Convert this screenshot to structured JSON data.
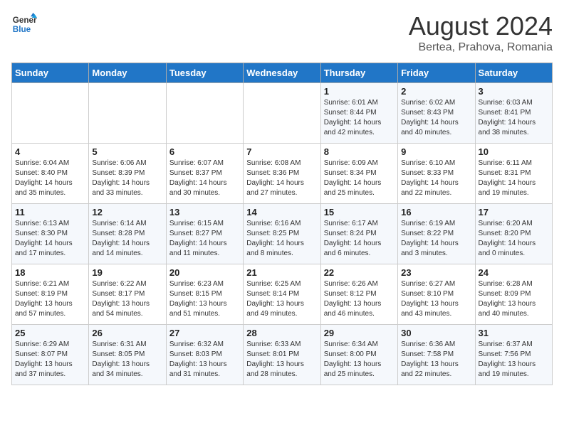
{
  "header": {
    "logo_line1": "General",
    "logo_line2": "Blue",
    "month_title": "August 2024",
    "location": "Bertea, Prahova, Romania"
  },
  "weekdays": [
    "Sunday",
    "Monday",
    "Tuesday",
    "Wednesday",
    "Thursday",
    "Friday",
    "Saturday"
  ],
  "weeks": [
    [
      {
        "day": "",
        "info": ""
      },
      {
        "day": "",
        "info": ""
      },
      {
        "day": "",
        "info": ""
      },
      {
        "day": "",
        "info": ""
      },
      {
        "day": "1",
        "info": "Sunrise: 6:01 AM\nSunset: 8:44 PM\nDaylight: 14 hours\nand 42 minutes."
      },
      {
        "day": "2",
        "info": "Sunrise: 6:02 AM\nSunset: 8:43 PM\nDaylight: 14 hours\nand 40 minutes."
      },
      {
        "day": "3",
        "info": "Sunrise: 6:03 AM\nSunset: 8:41 PM\nDaylight: 14 hours\nand 38 minutes."
      }
    ],
    [
      {
        "day": "4",
        "info": "Sunrise: 6:04 AM\nSunset: 8:40 PM\nDaylight: 14 hours\nand 35 minutes."
      },
      {
        "day": "5",
        "info": "Sunrise: 6:06 AM\nSunset: 8:39 PM\nDaylight: 14 hours\nand 33 minutes."
      },
      {
        "day": "6",
        "info": "Sunrise: 6:07 AM\nSunset: 8:37 PM\nDaylight: 14 hours\nand 30 minutes."
      },
      {
        "day": "7",
        "info": "Sunrise: 6:08 AM\nSunset: 8:36 PM\nDaylight: 14 hours\nand 27 minutes."
      },
      {
        "day": "8",
        "info": "Sunrise: 6:09 AM\nSunset: 8:34 PM\nDaylight: 14 hours\nand 25 minutes."
      },
      {
        "day": "9",
        "info": "Sunrise: 6:10 AM\nSunset: 8:33 PM\nDaylight: 14 hours\nand 22 minutes."
      },
      {
        "day": "10",
        "info": "Sunrise: 6:11 AM\nSunset: 8:31 PM\nDaylight: 14 hours\nand 19 minutes."
      }
    ],
    [
      {
        "day": "11",
        "info": "Sunrise: 6:13 AM\nSunset: 8:30 PM\nDaylight: 14 hours\nand 17 minutes."
      },
      {
        "day": "12",
        "info": "Sunrise: 6:14 AM\nSunset: 8:28 PM\nDaylight: 14 hours\nand 14 minutes."
      },
      {
        "day": "13",
        "info": "Sunrise: 6:15 AM\nSunset: 8:27 PM\nDaylight: 14 hours\nand 11 minutes."
      },
      {
        "day": "14",
        "info": "Sunrise: 6:16 AM\nSunset: 8:25 PM\nDaylight: 14 hours\nand 8 minutes."
      },
      {
        "day": "15",
        "info": "Sunrise: 6:17 AM\nSunset: 8:24 PM\nDaylight: 14 hours\nand 6 minutes."
      },
      {
        "day": "16",
        "info": "Sunrise: 6:19 AM\nSunset: 8:22 PM\nDaylight: 14 hours\nand 3 minutes."
      },
      {
        "day": "17",
        "info": "Sunrise: 6:20 AM\nSunset: 8:20 PM\nDaylight: 14 hours\nand 0 minutes."
      }
    ],
    [
      {
        "day": "18",
        "info": "Sunrise: 6:21 AM\nSunset: 8:19 PM\nDaylight: 13 hours\nand 57 minutes."
      },
      {
        "day": "19",
        "info": "Sunrise: 6:22 AM\nSunset: 8:17 PM\nDaylight: 13 hours\nand 54 minutes."
      },
      {
        "day": "20",
        "info": "Sunrise: 6:23 AM\nSunset: 8:15 PM\nDaylight: 13 hours\nand 51 minutes."
      },
      {
        "day": "21",
        "info": "Sunrise: 6:25 AM\nSunset: 8:14 PM\nDaylight: 13 hours\nand 49 minutes."
      },
      {
        "day": "22",
        "info": "Sunrise: 6:26 AM\nSunset: 8:12 PM\nDaylight: 13 hours\nand 46 minutes."
      },
      {
        "day": "23",
        "info": "Sunrise: 6:27 AM\nSunset: 8:10 PM\nDaylight: 13 hours\nand 43 minutes."
      },
      {
        "day": "24",
        "info": "Sunrise: 6:28 AM\nSunset: 8:09 PM\nDaylight: 13 hours\nand 40 minutes."
      }
    ],
    [
      {
        "day": "25",
        "info": "Sunrise: 6:29 AM\nSunset: 8:07 PM\nDaylight: 13 hours\nand 37 minutes."
      },
      {
        "day": "26",
        "info": "Sunrise: 6:31 AM\nSunset: 8:05 PM\nDaylight: 13 hours\nand 34 minutes."
      },
      {
        "day": "27",
        "info": "Sunrise: 6:32 AM\nSunset: 8:03 PM\nDaylight: 13 hours\nand 31 minutes."
      },
      {
        "day": "28",
        "info": "Sunrise: 6:33 AM\nSunset: 8:01 PM\nDaylight: 13 hours\nand 28 minutes."
      },
      {
        "day": "29",
        "info": "Sunrise: 6:34 AM\nSunset: 8:00 PM\nDaylight: 13 hours\nand 25 minutes."
      },
      {
        "day": "30",
        "info": "Sunrise: 6:36 AM\nSunset: 7:58 PM\nDaylight: 13 hours\nand 22 minutes."
      },
      {
        "day": "31",
        "info": "Sunrise: 6:37 AM\nSunset: 7:56 PM\nDaylight: 13 hours\nand 19 minutes."
      }
    ]
  ]
}
